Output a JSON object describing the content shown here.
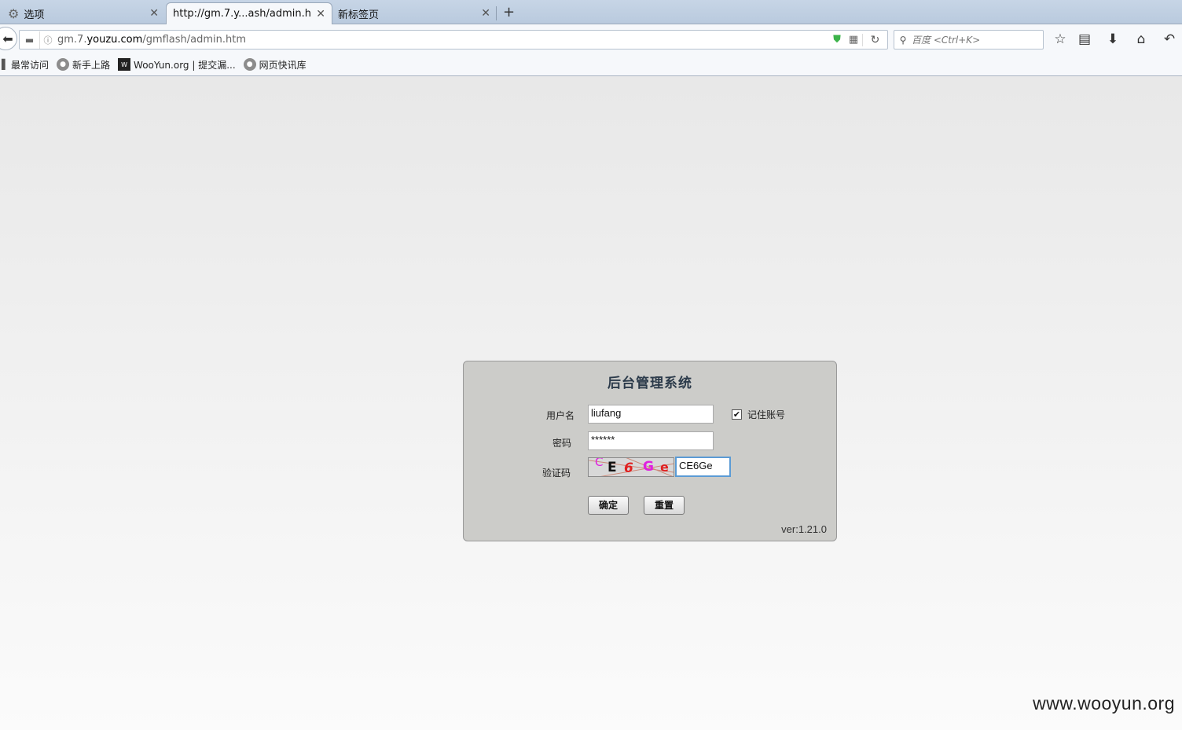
{
  "browser": {
    "tabs": [
      {
        "label": "选项",
        "icon": "gear-icon"
      },
      {
        "label": "http://gm.7.y...ash/admin.htm",
        "active": true
      },
      {
        "label": "新标签页"
      }
    ],
    "new_tab": "+",
    "url": {
      "prefix": "gm.7.",
      "domain": "youzu.com",
      "path": "/gmflash/admin.htm"
    },
    "search_placeholder": "百度 <Ctrl+K>",
    "bookmarks": [
      "最常访问",
      "新手上路",
      "WooYun.org | 提交漏...",
      "网页快讯库"
    ]
  },
  "login": {
    "title": "后台管理系统",
    "username_label": "用户名",
    "username_value": "liufang",
    "remember_label": "记住账号",
    "remember_checked": true,
    "password_label": "密码",
    "password_value": "******",
    "captcha_label": "验证码",
    "captcha_chars": [
      "C",
      "E",
      "6",
      "G",
      "e"
    ],
    "captcha_colors": [
      "#e020e0",
      "#111111",
      "#e02020",
      "#e020e0",
      "#e02020"
    ],
    "captcha_value": "CE6Ge",
    "submit_label": "确定",
    "reset_label": "重置",
    "version": "ver:1.21.0"
  },
  "watermark": "www.wooyun.org"
}
